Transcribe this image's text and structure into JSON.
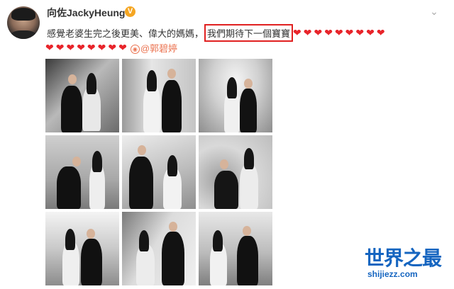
{
  "post": {
    "username": "向佐JackyHeung",
    "verified_badge": "V",
    "menu_icon": "chevron-down-icon",
    "text_main": "感覺老婆生完之後更美、偉大的媽媽，",
    "text_highlight": "我們期待下一個寶寶",
    "hearts_line1": "❤❤❤❤❤❤❤❤❤",
    "hearts_line2": "❤❤❤❤❤❤❤❤",
    "mention": "@郭碧婷"
  },
  "watermark": {
    "title": "世界之最",
    "url": "shijiezz.com"
  },
  "colors": {
    "heart": "#e8242a",
    "highlight_border": "#e02020",
    "mention": "#eb7350",
    "watermark": "#1565c0",
    "badge": "#f5a623"
  }
}
